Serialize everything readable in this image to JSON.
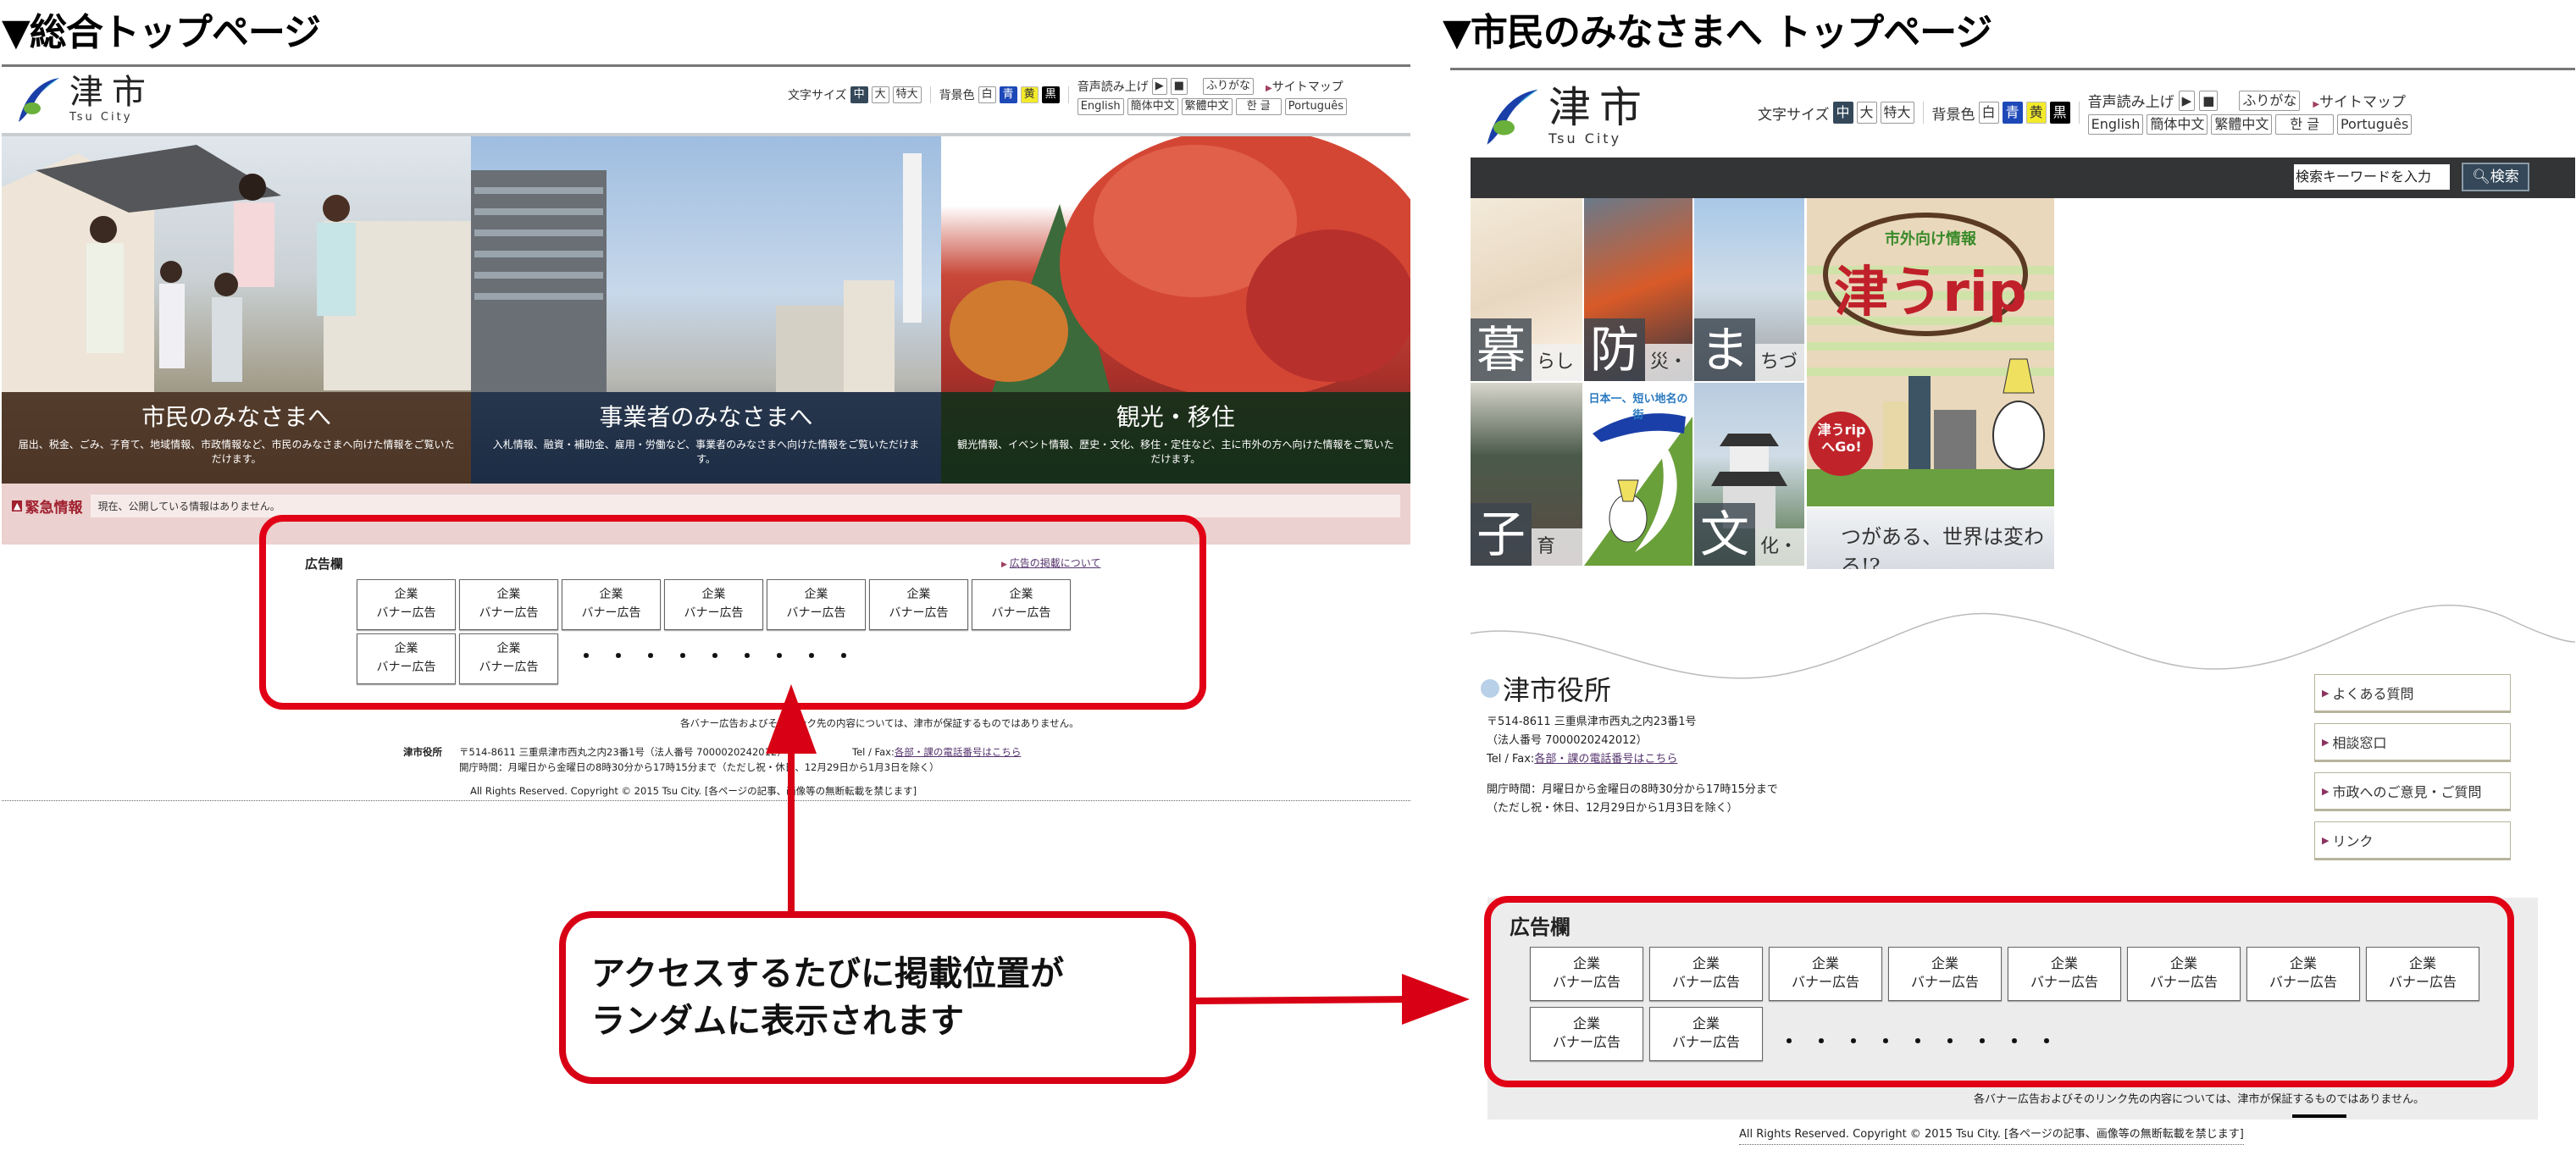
{
  "left": {
    "heading": "▼総合トップページ",
    "logo": {
      "kanji": "津市",
      "english": "Tsu City"
    },
    "toolbar": {
      "font_size_label": "文字サイズ",
      "font_sizes": [
        "中",
        "大",
        "特大"
      ],
      "bg_label": "背景色",
      "bg_colors": [
        "白",
        "青",
        "黄",
        "黒"
      ],
      "speech_label": "音声読み上げ",
      "play_icon": "▶",
      "stop_icon": "■",
      "furigana": "ふりがな",
      "sitemap": "サイトマップ",
      "languages": [
        "English",
        "簡体中文",
        "繁體中文",
        "한 글",
        "Português"
      ]
    },
    "hero": [
      {
        "title": "市民のみなさまへ",
        "desc": "届出、税金、ごみ、子育て、地域情報、市政情報など、市民のみなさまへ向けた情報をご覧いただけます。",
        "overlay": "#4a3222"
      },
      {
        "title": "事業者のみなさまへ",
        "desc": "入札情報、融資・補助金、雇用・労働など、事業者のみなさまへ向けた情報をご覧いただけます。",
        "overlay": "#15253f"
      },
      {
        "title": "観光・移住",
        "desc": "観光情報、イベント情報、歴史・文化、移住・定住など、主に市外の方へ向けた情報をご覧いただけます。",
        "overlay": "#12301a"
      }
    ],
    "emergency": {
      "label": "緊急情報",
      "message": "現在、公開している情報はありません。"
    },
    "ads": {
      "title": "広告欄",
      "about_link": "広告の掲載について",
      "banner_line1": "企業",
      "banner_line2": "バナー広告",
      "banner_count": 9,
      "ellipsis": "・・・・・・・・・"
    },
    "disclaimer": "各バナー広告およびそのリンク先の内容については、津市が保証するものではありません。",
    "footer": {
      "office": "津市役所",
      "address": "〒514-8611 三重県津市西丸之内23番1号（法人番号 7000020242012）",
      "tel_label": "Tel / Fax:",
      "tel_link": "各部・課の電話番号はこちら",
      "hours": "開庁時間：月曜日から金曜日の8時30分から17時15分まで（ただし祝・休日、12月29日から1月3日を除く）",
      "copyright": "All Rights Reserved. Copyright © 2015 Tsu City.  [各ページの記事、画像等の無断転載を禁じます]"
    }
  },
  "right": {
    "heading": "▼市民のみなさまへ トップページ",
    "logo": {
      "kanji": "津市",
      "english": "Tsu City"
    },
    "search": {
      "placeholder": "検索キーワードを入力",
      "button": "検索"
    },
    "tiles": [
      {
        "char": "暮",
        "rest": "らし"
      },
      {
        "char": "防",
        "rest": "災・救急"
      },
      {
        "char": "ま",
        "rest": "ちづくり"
      },
      {
        "char": "子",
        "rest": "育て・教育"
      },
      {
        "char": "文",
        "rest": "化・スポーツ"
      }
    ],
    "mascot_banner": "日本一、短い地名の街",
    "trip_banner": {
      "sub": "市外向け情報",
      "title": "津うrip",
      "go": "津うripへGo!"
    },
    "slogan_banner": "つがある、世界は変わる!?",
    "office": {
      "name": "津市役所",
      "address": "〒514-8611 三重県津市西丸之内23番1号",
      "corp_no": "（法人番号 7000020242012）",
      "tel_label": "Tel / Fax:",
      "tel_link": "各部・課の電話番号はこちら",
      "hours1": "開庁時間：月曜日から金曜日の8時30分から17時15分まで",
      "hours2": "（ただし祝・休日、12月29日から1月3日を除く）"
    },
    "side_links": [
      "よくある質問",
      "相談窓口",
      "市政へのご意見・ご質問",
      "リンク"
    ],
    "ads": {
      "title": "広告欄",
      "banner_line1": "企業",
      "banner_line2": "バナー広告",
      "banner_count": 10,
      "ellipsis": "・・・・・・・・・"
    },
    "disclaimer": "各バナー広告およびそのリンク先の内容については、津市が保証するものではありません。",
    "copyright": "All Rights Reserved. Copyright © 2015 Tsu City.  [各ページの記事、画像等の無断転載を禁じます]"
  },
  "callout": {
    "line1": "アクセスするたびに掲載位置が",
    "line2": "ランダムに表示されます",
    "color": "#d80015"
  }
}
